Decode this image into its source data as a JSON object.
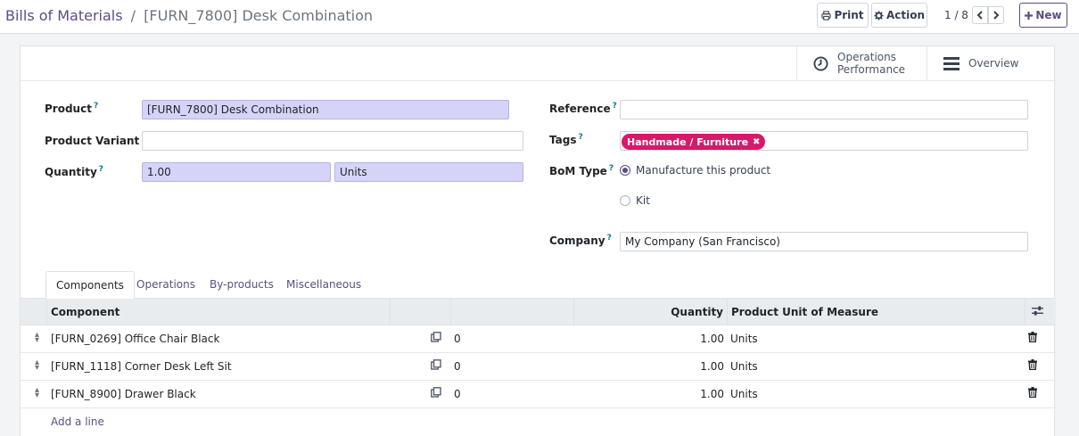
{
  "breadcrumb": {
    "parent": "Bills of Materials",
    "separator": "/",
    "current": "[FURN_7800] Desk Combination"
  },
  "toolbar": {
    "print_label": "Print",
    "action_label": "Action",
    "pager": "1 / 8",
    "new_label": "New"
  },
  "smart_buttons": {
    "operations_line1": "Operations",
    "operations_line2": "Performance",
    "overview": "Overview"
  },
  "form": {
    "product_label": "Product",
    "product_value": "[FURN_7800] Desk Combination",
    "variant_label": "Product Variant",
    "variant_value": "",
    "quantity_label": "Quantity",
    "quantity_value": "1.00",
    "uom_value": "Units",
    "reference_label": "Reference",
    "reference_value": "",
    "tags_label": "Tags",
    "tag_value": "Handmade / Furniture",
    "bom_type_label": "BoM Type",
    "bom_type_options": [
      "Manufacture this product",
      "Kit"
    ],
    "bom_type_selected": "Manufacture this product",
    "company_label": "Company",
    "company_value": "My Company (San Francisco)",
    "help_marker": "?"
  },
  "tabs": [
    "Components",
    "Operations",
    "By-products",
    "Miscellaneous"
  ],
  "table": {
    "headers": {
      "component": "Component",
      "quantity": "Quantity",
      "uom": "Product Unit of Measure"
    },
    "rows": [
      {
        "component": "[FURN_0269] Office Chair Black",
        "count": "0",
        "quantity": "1.00",
        "uom": "Units"
      },
      {
        "component": "[FURN_1118] Corner Desk Left Sit",
        "count": "0",
        "quantity": "1.00",
        "uom": "Units"
      },
      {
        "component": "[FURN_8900] Drawer Black",
        "count": "0",
        "quantity": "1.00",
        "uom": "Units"
      }
    ],
    "add_line": "Add a line"
  },
  "colors": {
    "brand": "#5e4d82",
    "required_field": "#d5d4f8",
    "tag": "#d7196a"
  }
}
